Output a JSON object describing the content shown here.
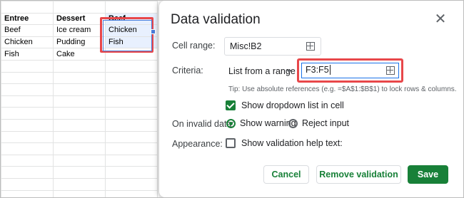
{
  "sheet": {
    "rows": [
      [
        "",
        "",
        ""
      ],
      [
        "Entree",
        "Dessert",
        "Beef"
      ],
      [
        "Beef",
        "Ice cream",
        "Chicken"
      ],
      [
        "Chicken",
        "Pudding",
        "Fish"
      ],
      [
        "Fish",
        "Cake",
        ""
      ],
      [
        "",
        "",
        ""
      ],
      [
        "",
        "",
        ""
      ],
      [
        "",
        "",
        ""
      ],
      [
        "",
        "",
        ""
      ],
      [
        "",
        "",
        ""
      ],
      [
        "",
        "",
        ""
      ],
      [
        "",
        "",
        ""
      ],
      [
        "",
        "",
        ""
      ],
      [
        "",
        "",
        ""
      ],
      [
        "",
        "",
        ""
      ],
      [
        "",
        "",
        ""
      ],
      [
        "",
        "",
        ""
      ]
    ]
  },
  "dialog": {
    "title": "Data validation",
    "close_icon": "close-icon",
    "cell_range_label": "Cell range:",
    "cell_range_value": "Misc!B2",
    "criteria_label": "Criteria:",
    "criteria_type": "List from a range",
    "criteria_range": "F3:F5",
    "tip": "Tip: Use absolute references (e.g. =$A$1:$B$1) to lock rows & columns.",
    "show_dropdown_label": "Show dropdown list in cell",
    "show_dropdown_checked": true,
    "invalid_label": "On invalid data:",
    "show_warning_label": "Show warning",
    "reject_input_label": "Reject input",
    "invalid_selected": "Show warning",
    "appearance_label": "Appearance:",
    "help_text_label": "Show validation help text:",
    "help_text_checked": false,
    "cancel_label": "Cancel",
    "remove_label": "Remove validation",
    "save_label": "Save"
  },
  "colors": {
    "accent_green": "#188038",
    "highlight_red": "#e8474a",
    "selection_blue": "#4a7bd8"
  }
}
